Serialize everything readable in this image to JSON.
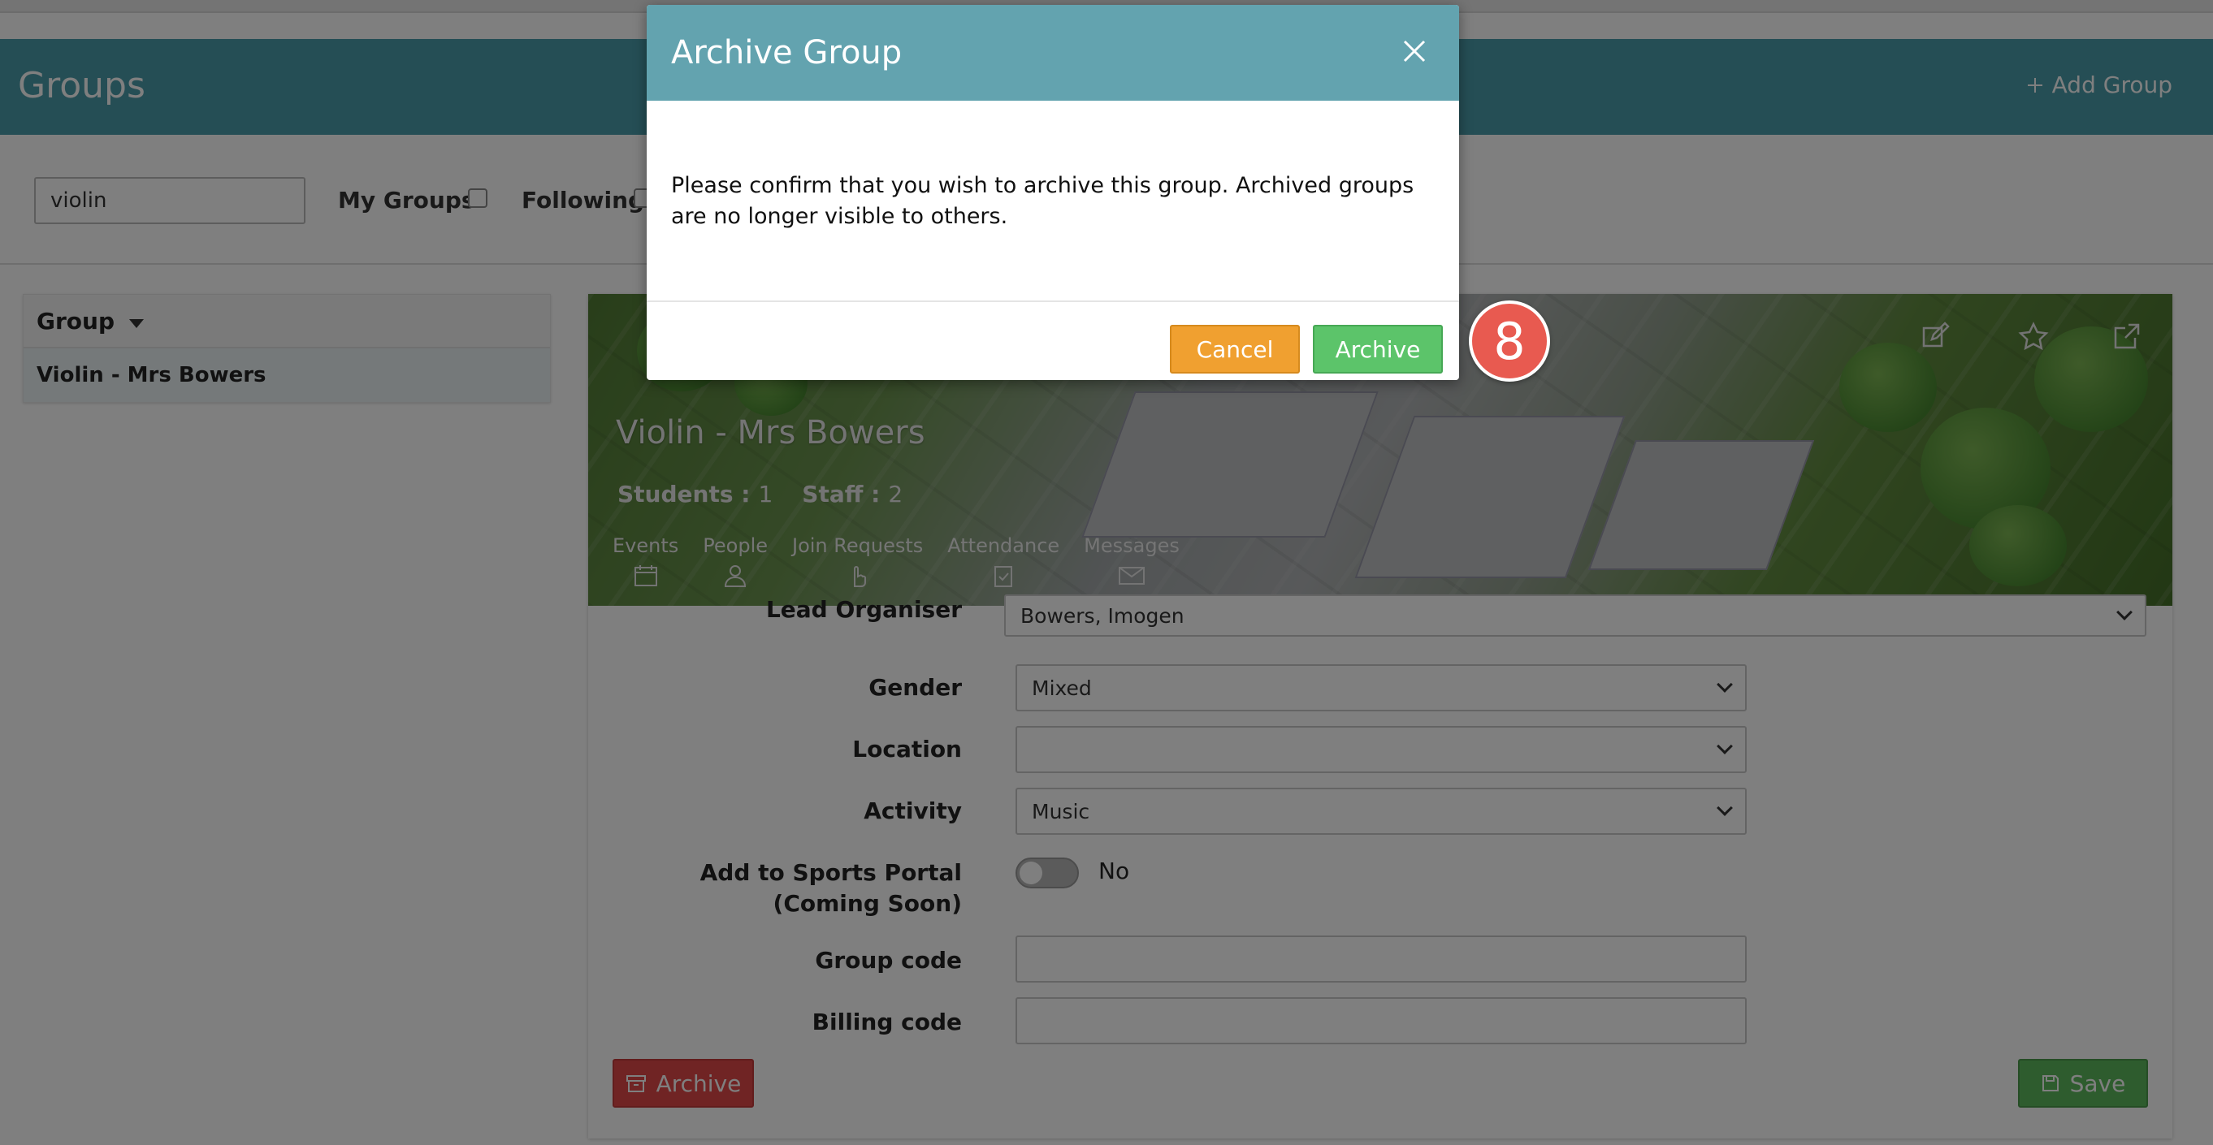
{
  "header": {
    "title": "Groups",
    "add_group_label": "Add Group"
  },
  "filters": {
    "search_value": "violin",
    "my_groups_label": "My Groups",
    "following_label": "Following"
  },
  "group_list": {
    "column_header": "Group",
    "rows": [
      {
        "name": "Violin - Mrs Bowers",
        "selected": true
      }
    ]
  },
  "group_detail": {
    "name": "Violin - Mrs Bowers",
    "students_label": "Students :",
    "students_count": "1",
    "staff_label": "Staff :",
    "staff_count": "2",
    "tabs": [
      {
        "label": "Events",
        "icon": "calendar-icon"
      },
      {
        "label": "People",
        "icon": "person-icon"
      },
      {
        "label": "Join Requests",
        "icon": "hand-pointer-icon"
      },
      {
        "label": "Attendance",
        "icon": "clipboard-check-icon"
      },
      {
        "label": "Messages",
        "icon": "envelope-icon"
      }
    ]
  },
  "form": {
    "lead_organiser_label": "Lead Organiser",
    "lead_organiser_value": "Bowers, Imogen",
    "gender_label": "Gender",
    "gender_value": "Mixed",
    "location_label": "Location",
    "location_value": "",
    "activity_label": "Activity",
    "activity_value": "Music",
    "sports_portal_label": "Add to Sports Portal (Coming Soon)",
    "sports_portal_value": "No",
    "sports_portal_on": false,
    "group_code_label": "Group code",
    "group_code_value": "",
    "billing_code_label": "Billing code",
    "billing_code_value": "",
    "archive_button": "Archive",
    "save_button": "Save"
  },
  "modal": {
    "title": "Archive Group",
    "body": "Please confirm that you wish to archive this group. Archived groups are no longer visible to others.",
    "cancel_label": "Cancel",
    "confirm_label": "Archive"
  },
  "step_badge": "8",
  "colors": {
    "header_teal": "#4a9daa",
    "modal_header": "#63a3af",
    "cancel_orange": "#f0a030",
    "confirm_green": "#5cc46a",
    "danger_red": "#e04848",
    "badge_red": "#e85a50"
  }
}
